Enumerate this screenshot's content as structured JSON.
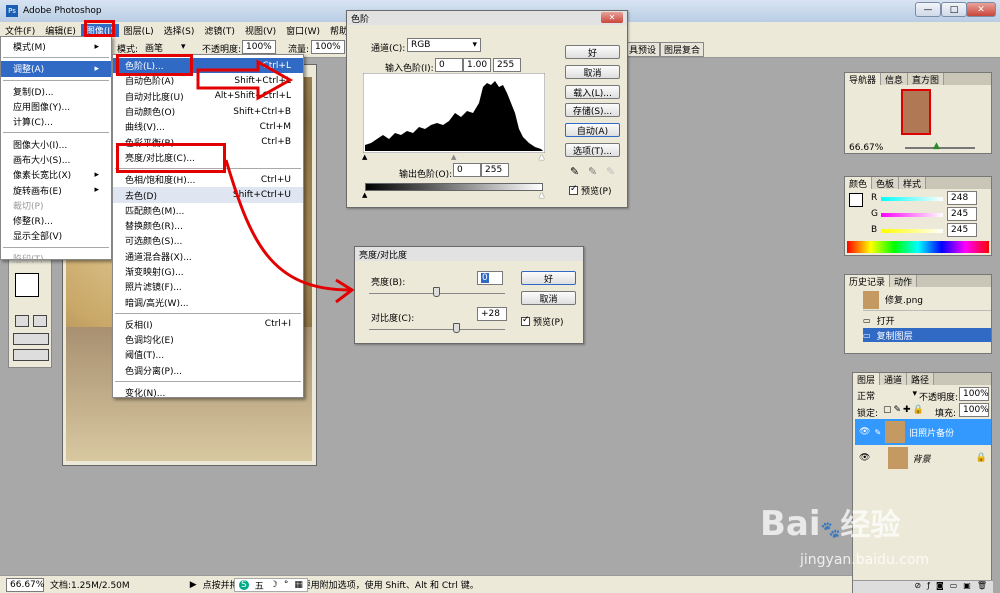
{
  "window": {
    "title": "Adobe Photoshop",
    "min": "—",
    "max": "□",
    "close": "✕"
  },
  "menubar": [
    "文件(F)",
    "编辑(E)",
    "图像(I)",
    "图层(L)",
    "选择(S)",
    "滤镜(T)",
    "视图(V)",
    "窗口(W)",
    "帮助(H)"
  ],
  "options": {
    "mode_label": "模式:",
    "mode_value": "画笔",
    "opacity_label": "不透明度:",
    "opacity_value": "100%",
    "flow_label": "流量:",
    "flow_value": "100%",
    "palette_tabs": [
      "具预设",
      "图层复合"
    ]
  },
  "image_menu": [
    {
      "label": "模式(M)",
      "arrow": "▸"
    },
    {
      "label": "调整(A)",
      "arrow": "▸"
    },
    {
      "label": "复制(D)..."
    },
    {
      "label": "应用图像(Y)..."
    },
    {
      "label": "计算(C)..."
    },
    {
      "label": "图像大小(I)..."
    },
    {
      "label": "画布大小(S)..."
    },
    {
      "label": "像素长宽比(X)",
      "arrow": "▸"
    },
    {
      "label": "旋转画布(E)",
      "arrow": "▸"
    },
    {
      "label": "裁切(P)"
    },
    {
      "label": "修整(R)..."
    },
    {
      "label": "显示全部(V)"
    },
    {
      "label": "陷印(T)..."
    }
  ],
  "adjust_menu": [
    {
      "label": "色阶(L)...",
      "shortcut": "Ctrl+L"
    },
    {
      "label": "自动色阶(A)",
      "shortcut": "Shift+Ctrl+L"
    },
    {
      "label": "自动对比度(U)",
      "shortcut": "Alt+Shift+Ctrl+L"
    },
    {
      "label": "自动颜色(O)",
      "shortcut": "Shift+Ctrl+B"
    },
    {
      "label": "曲线(V)...",
      "shortcut": "Ctrl+M"
    },
    {
      "label": "色彩平衡(B)...",
      "shortcut": "Ctrl+B"
    },
    {
      "label": "亮度/对比度(C)...",
      "shortcut": ""
    },
    {
      "label": "色相/饱和度(H)...",
      "shortcut": "Ctrl+U"
    },
    {
      "label": "去色(D)",
      "shortcut": "Shift+Ctrl+U"
    },
    {
      "label": "匹配颜色(M)...",
      "shortcut": ""
    },
    {
      "label": "替换颜色(R)...",
      "shortcut": ""
    },
    {
      "label": "可选颜色(S)...",
      "shortcut": ""
    },
    {
      "label": "通道混合器(X)...",
      "shortcut": ""
    },
    {
      "label": "渐变映射(G)...",
      "shortcut": ""
    },
    {
      "label": "照片滤镜(F)...",
      "shortcut": ""
    },
    {
      "label": "暗调/高光(W)...",
      "shortcut": ""
    },
    {
      "label": "反相(I)",
      "shortcut": "Ctrl+I"
    },
    {
      "label": "色调均化(E)",
      "shortcut": ""
    },
    {
      "label": "阈值(T)...",
      "shortcut": ""
    },
    {
      "label": "色调分离(P)...",
      "shortcut": ""
    },
    {
      "label": "变化(N)...",
      "shortcut": ""
    }
  ],
  "levels": {
    "title": "色阶",
    "channel_label": "通道(C):",
    "channel_value": "RGB",
    "input_label": "输入色阶(I):",
    "input_black": "0",
    "input_gamma": "1.00",
    "input_white": "255",
    "output_label": "输出色阶(O):",
    "output_black": "0",
    "output_white": "255",
    "ok": "好",
    "cancel": "取消",
    "load": "载入(L)...",
    "save": "存储(S)...",
    "auto": "自动(A)",
    "options": "选项(T)...",
    "preview": "预览(P)"
  },
  "bc": {
    "title": "亮度/对比度",
    "brightness_label": "亮度(B):",
    "brightness_value": "0",
    "contrast_label": "对比度(C):",
    "contrast_value": "+28",
    "ok": "好",
    "cancel": "取消",
    "preview": "预览(P)"
  },
  "navigator": {
    "tabs": [
      "导航器",
      "信息",
      "直方图"
    ],
    "zoom": "66.67%"
  },
  "color": {
    "tabs": [
      "颜色",
      "色板",
      "样式"
    ],
    "r_label": "R",
    "r": "248",
    "g_label": "G",
    "g": "245",
    "b_label": "B",
    "b": "245"
  },
  "history": {
    "tabs": [
      "历史记录",
      "动作"
    ],
    "items": [
      "修复.png",
      "打开",
      "复制图层"
    ]
  },
  "layers": {
    "tabs": [
      "图层",
      "通道",
      "路径"
    ],
    "blend": "正常",
    "opacity_label": "不透明度:",
    "opacity": "100%",
    "lock_label": "锁定:",
    "fill_label": "填充:",
    "fill": "100%",
    "items": [
      "旧照片备份",
      "背景"
    ]
  },
  "status": {
    "zoom": "66.67%",
    "doc": "文档:1.25M/2.50M",
    "hint": "点按并拖移以绘制选区。要用附加选项，使用 Shift、Alt 和 Ctrl 键。"
  },
  "taskbar": {
    "ime_items": [
      "S",
      "五",
      "☽",
      "°",
      "▦"
    ]
  },
  "watermark": {
    "brand": "Bai",
    "cn": "经验",
    "url": "jingyan.baidu.com"
  },
  "colors": {
    "accent": "#316ac5",
    "red_annotation": "#e30000",
    "selection": "#3399ff"
  }
}
